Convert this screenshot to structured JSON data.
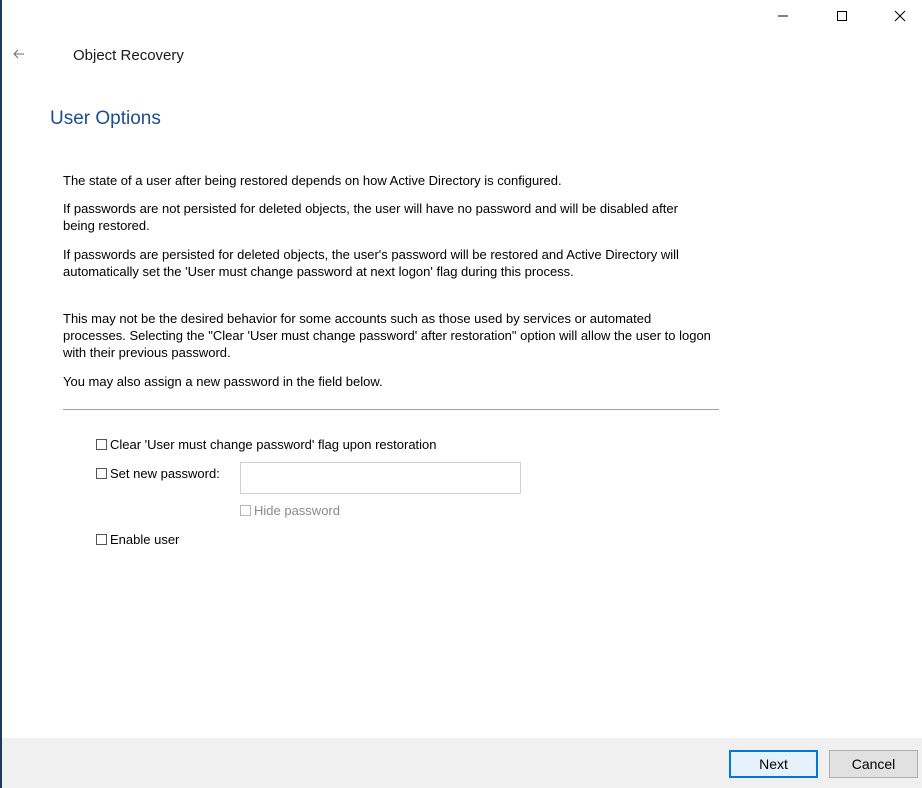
{
  "window": {
    "title": "Object Recovery",
    "controls": {
      "minimize_icon": "minimize-icon",
      "maximize_icon": "maximize-icon",
      "close_icon": "close-icon"
    },
    "back_icon": "back-arrow-icon"
  },
  "page": {
    "title": "User Options",
    "paragraphs": [
      "The state of a user after being restored depends on how Active Directory is configured.",
      "If passwords are not persisted for deleted objects, the user will have no password and will be disabled after being restored.",
      "If passwords are persisted for deleted objects, the user's password will be restored and Active Directory will automatically set the 'User must change password at next logon' flag during this process.",
      "This may not be the desired behavior for some accounts such as those used by services or automated processes.  Selecting the \"Clear 'User must change password' after restoration\" option will allow the user to logon with their previous password.",
      "You may also assign a new password in the field below."
    ]
  },
  "options": {
    "clear_flag": {
      "label": "Clear 'User must change password' flag upon restoration",
      "checked": false
    },
    "set_password": {
      "label": "Set new password:",
      "checked": false,
      "value": "",
      "placeholder": ""
    },
    "hide_password": {
      "label": "Hide password",
      "checked": false,
      "disabled": true
    },
    "enable_user": {
      "label": "Enable user",
      "checked": false
    }
  },
  "footer": {
    "next_label": "Next",
    "cancel_label": "Cancel"
  },
  "colors": {
    "title": "#1e4e8c",
    "accent": "#0078d7",
    "footer_bg": "#f0f0f0"
  }
}
